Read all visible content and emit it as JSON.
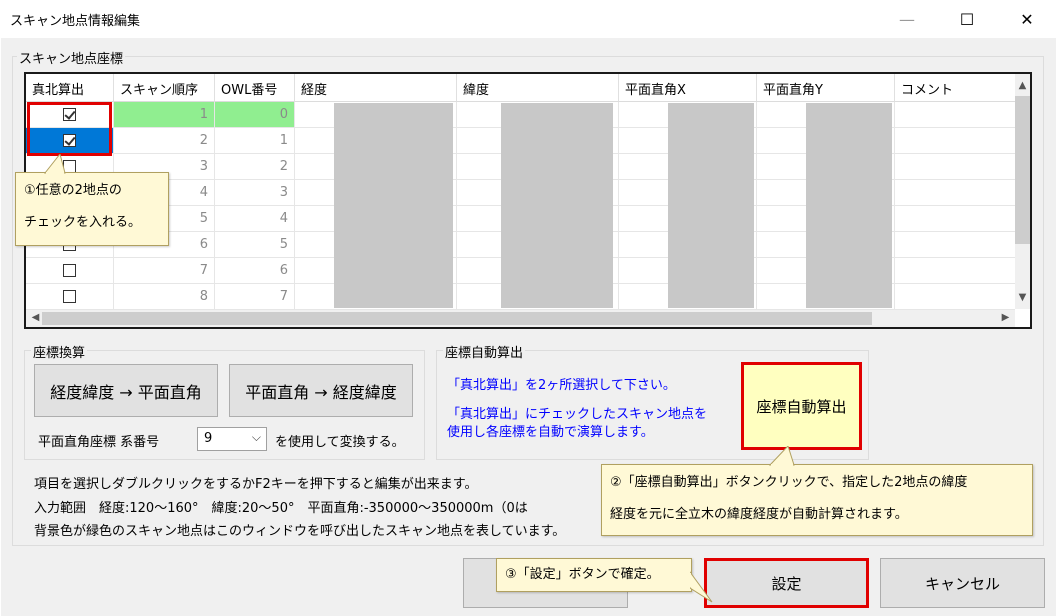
{
  "window": {
    "title": "スキャン地点情報編集",
    "minimize_icon": "minimize-icon",
    "maximize_icon": "maximize-icon",
    "close_icon": "close-icon"
  },
  "scan_group": {
    "label": "スキャン地点座標"
  },
  "grid": {
    "columns": [
      "真北算出",
      "スキャン順序",
      "OWL番号",
      "経度",
      "緯度",
      "平面直角X",
      "平面直角Y",
      "コメント"
    ],
    "rows": [
      {
        "checked": true,
        "order": "1",
        "owl": "0"
      },
      {
        "checked": true,
        "order": "2",
        "owl": "1"
      },
      {
        "checked": false,
        "order": "3",
        "owl": "2"
      },
      {
        "checked": false,
        "order": "4",
        "owl": "3"
      },
      {
        "checked": false,
        "order": "5",
        "owl": "4"
      },
      {
        "checked": false,
        "order": "6",
        "owl": "5"
      },
      {
        "checked": false,
        "order": "7",
        "owl": "6"
      },
      {
        "checked": false,
        "order": "8",
        "owl": "7"
      }
    ],
    "highlight_color": "#90ee90",
    "selection_color": "#0078d7"
  },
  "convert_group": {
    "label": "座標換算",
    "btn_to_plane": "経度緯度 → 平面直角",
    "btn_to_latlon": "平面直角 → 経度緯度",
    "system_label": "平面直角座標 系番号",
    "system_value": "9",
    "system_suffix": "を使用して変換する。"
  },
  "auto_group": {
    "label": "座標自動算出",
    "line1": "「真北算出」を2ヶ所選択して下さい。",
    "line2a": "「真北算出」にチェックしたスキャン地点を",
    "line2b": "使用し各座標を自動で演算します。",
    "button": "座標自動算出"
  },
  "notes": {
    "line1": "項目を選択しダブルクリックをするかF2キーを押下すると編集が出来ます。",
    "line2": "入力範囲　経度:120～160°　緯度:20～50°　平面直角:-350000～350000m（0は",
    "line3": "背景色が緑色のスキャン地点はこのウィンドウを呼び出したスキャン地点を表しています。"
  },
  "footer": {
    "ok_label": "設定",
    "cancel_label": "キャンセル"
  },
  "callouts": {
    "c1_line1": "①任意の2地点の",
    "c1_line2": "チェックを入れる。",
    "c2_line1": "②「座標自動算出」ボタンクリックで、指定した2地点の緯度",
    "c2_line2": "経度を元に全立木の緯度経度が自動計算されます。",
    "c3": "③「設定」ボタンで確定。"
  },
  "accent_red": "#e00000",
  "callout_bg": "#fff9d6"
}
